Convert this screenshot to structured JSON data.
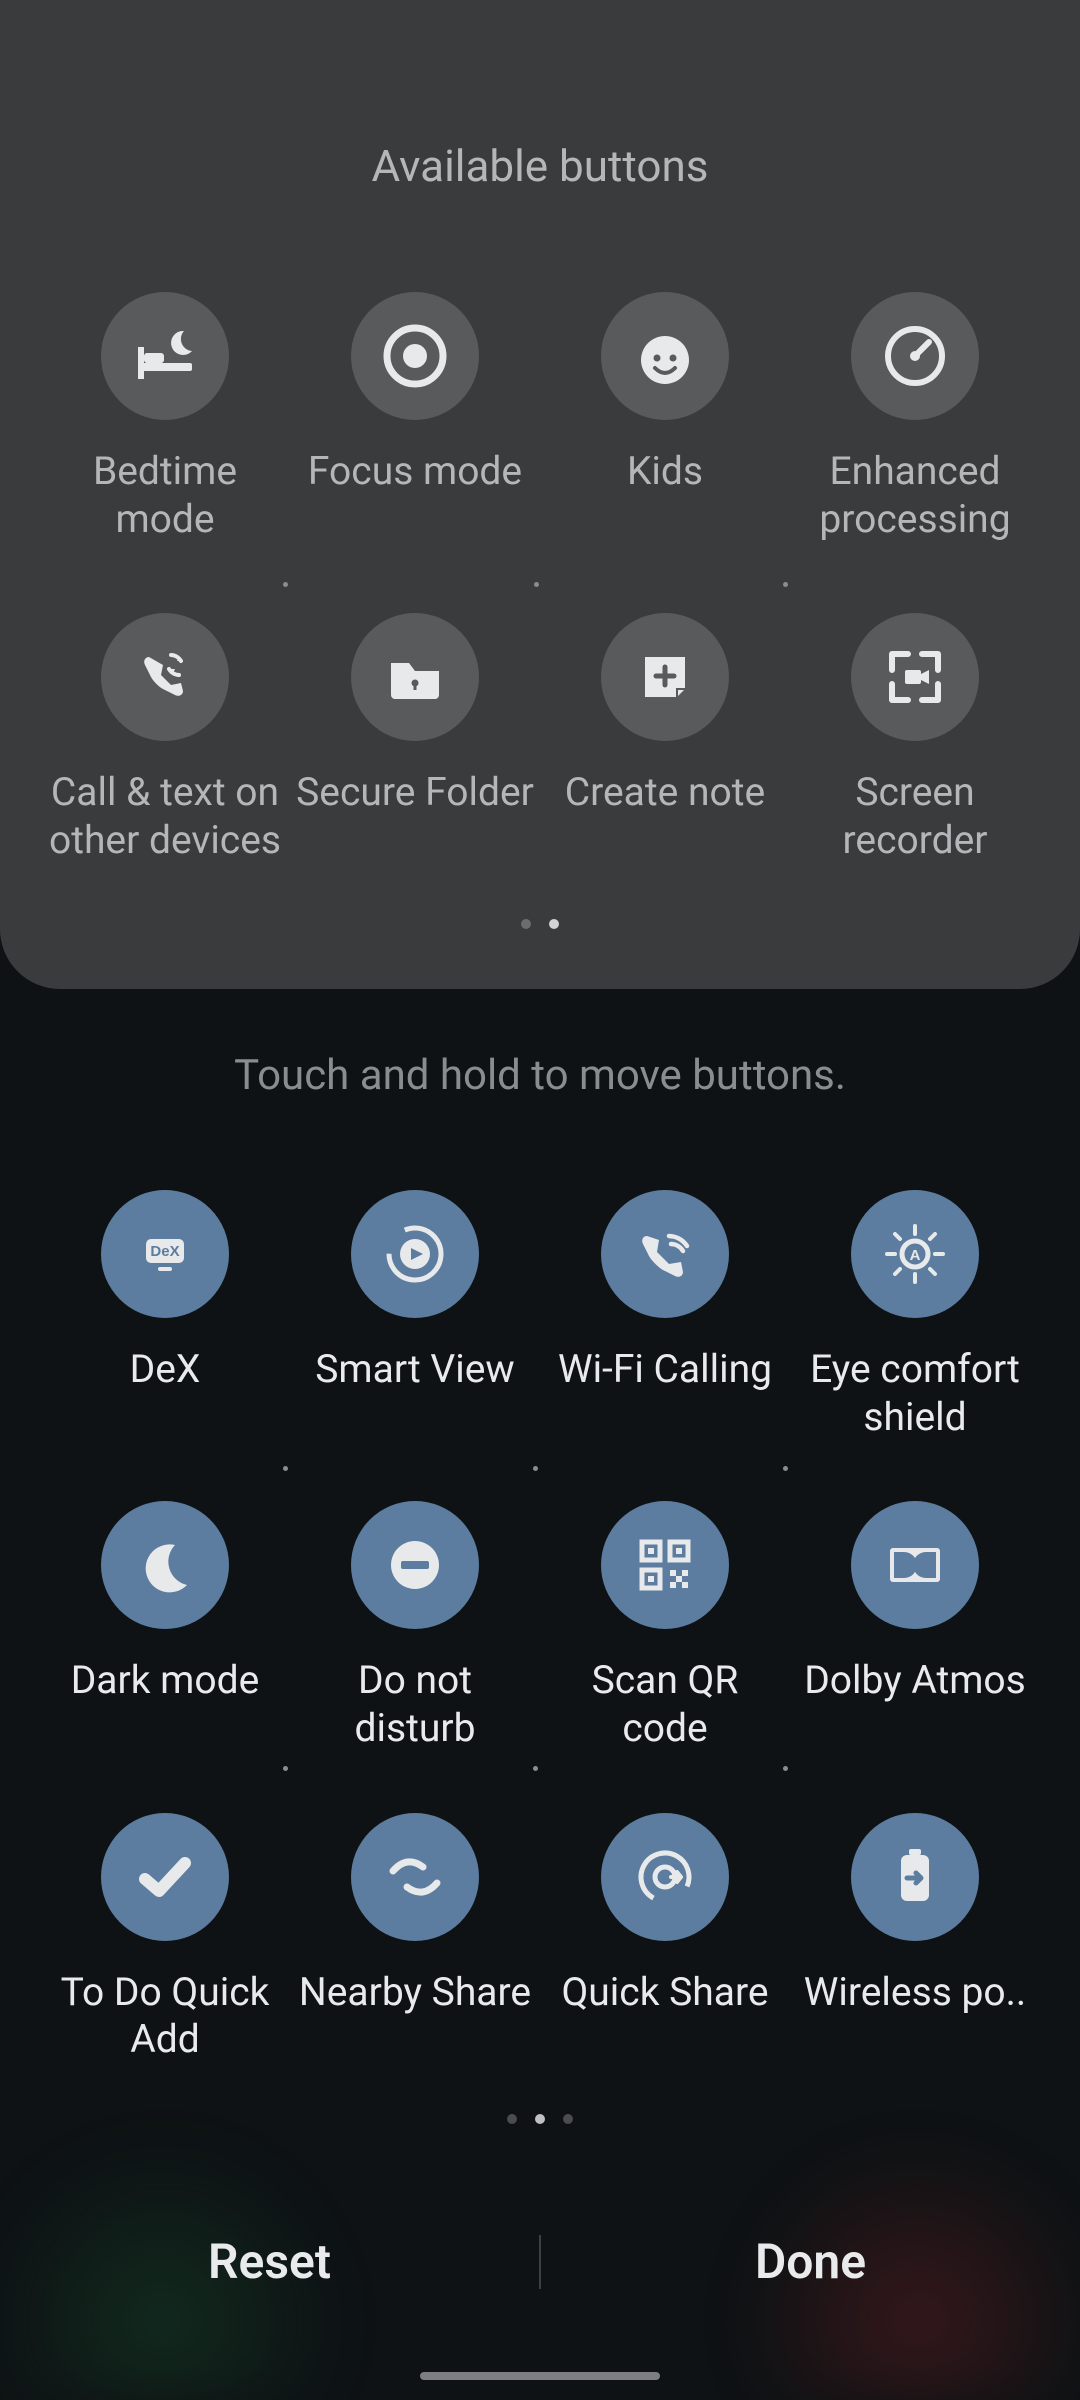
{
  "panel": {
    "title": "Available buttons",
    "items": [
      {
        "id": "bedtime-mode",
        "label": "Bedtime mode",
        "icon": "bed-moon-icon"
      },
      {
        "id": "focus-mode",
        "label": "Focus mode",
        "icon": "target-icon"
      },
      {
        "id": "kids",
        "label": "Kids",
        "icon": "kid-face-icon"
      },
      {
        "id": "enhanced-processing",
        "label": "Enhanced processing",
        "icon": "gauge-icon"
      },
      {
        "id": "call-text-other-devices",
        "label": "Call & text on other devices",
        "icon": "phone-sync-icon"
      },
      {
        "id": "secure-folder",
        "label": "Secure Folder",
        "icon": "folder-lock-icon"
      },
      {
        "id": "create-note",
        "label": "Create note",
        "icon": "note-plus-icon"
      },
      {
        "id": "screen-recorder",
        "label": "Screen recorder",
        "icon": "screen-record-icon"
      }
    ],
    "page": {
      "current": 2,
      "total": 2
    }
  },
  "instruction": "Touch and hold to move buttons.",
  "active": {
    "items": [
      {
        "id": "dex",
        "label": "DeX",
        "icon": "dex-icon"
      },
      {
        "id": "smart-view",
        "label": "Smart View",
        "icon": "cast-play-icon"
      },
      {
        "id": "wifi-calling",
        "label": "Wi-Fi Calling",
        "icon": "phone-wifi-icon"
      },
      {
        "id": "eye-comfort-shield",
        "label": "Eye comfort shield",
        "icon": "eye-comfort-icon"
      },
      {
        "id": "dark-mode",
        "label": "Dark mode",
        "icon": "moon-icon"
      },
      {
        "id": "do-not-disturb",
        "label": "Do not disturb",
        "icon": "minus-circle-icon"
      },
      {
        "id": "scan-qr-code",
        "label": "Scan QR code",
        "icon": "qr-icon"
      },
      {
        "id": "dolby-atmos",
        "label": "Dolby Atmos",
        "icon": "dolby-icon"
      },
      {
        "id": "to-do-quick-add",
        "label": "To Do Quick Add",
        "icon": "check-icon"
      },
      {
        "id": "nearby-share",
        "label": "Nearby Share",
        "icon": "nearby-share-icon"
      },
      {
        "id": "quick-share",
        "label": "Quick Share",
        "icon": "quick-share-icon"
      },
      {
        "id": "wireless-power",
        "label": "Wireless po..",
        "icon": "battery-share-icon"
      }
    ],
    "page": {
      "current": 2,
      "total": 3
    }
  },
  "footer": {
    "reset": "Reset",
    "done": "Done"
  }
}
